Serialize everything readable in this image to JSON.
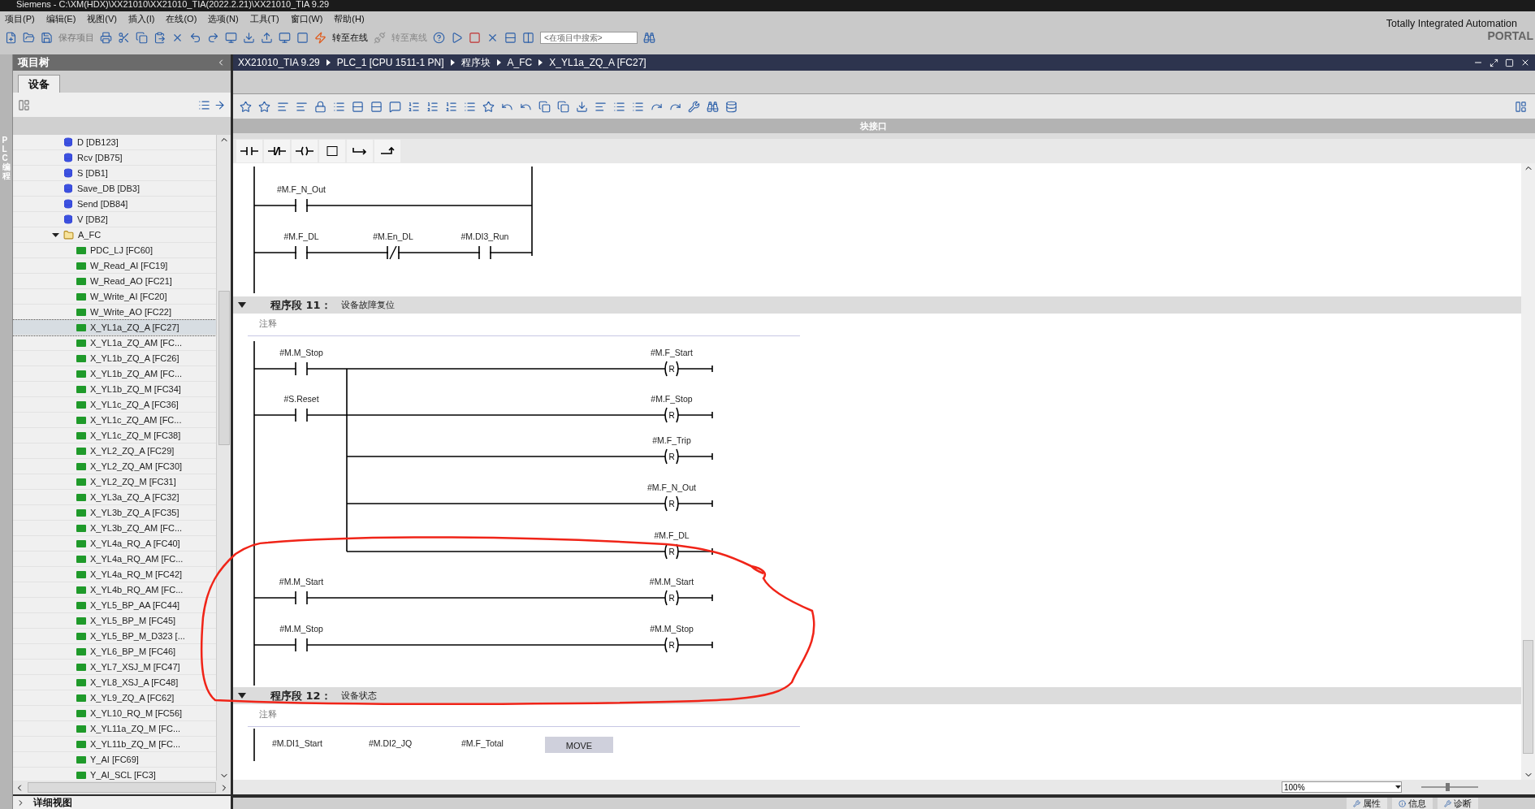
{
  "title_bar": {
    "title": "Siemens - C:\\XM(HDX)\\XX21010\\XX21010_TIA(2022.2.21)\\XX21010_TIA 9.29"
  },
  "menu": [
    "项目(P)",
    "编辑(E)",
    "视图(V)",
    "插入(I)",
    "在线(O)",
    "选项(N)",
    "工具(T)",
    "窗口(W)",
    "帮助(H)"
  ],
  "toolbar": {
    "save": "保存项目",
    "go_online": "转至在线",
    "go_offline": "转至离线",
    "search_placeholder": "<在项目中搜索>"
  },
  "brand": {
    "line_1": "Totally Integrated Automation",
    "line_2": "PORTAL"
  },
  "side_tab": "PLC 编程",
  "project_tree": {
    "title": "项目树",
    "tab": "设备",
    "items": [
      {
        "label": "D [DB123]",
        "kind": "db",
        "selected": false
      },
      {
        "label": "Rcv [DB75]",
        "kind": "db",
        "selected": false
      },
      {
        "label": "S [DB1]",
        "kind": "db",
        "selected": false
      },
      {
        "label": "Save_DB [DB3]",
        "kind": "db",
        "selected": false
      },
      {
        "label": "Send [DB84]",
        "kind": "db",
        "selected": false
      },
      {
        "label": "V [DB2]",
        "kind": "db",
        "selected": false
      },
      {
        "label": "A_FC",
        "kind": "folder",
        "selected": false,
        "expanded": true,
        "children": [
          {
            "label": "PDC_LJ [FC60]",
            "kind": "fc",
            "selected": false
          },
          {
            "label": "W_Read_AI [FC19]",
            "kind": "fc",
            "selected": false
          },
          {
            "label": "W_Read_AO [FC21]",
            "kind": "fc",
            "selected": false
          },
          {
            "label": "W_Write_AI [FC20]",
            "kind": "fc",
            "selected": false
          },
          {
            "label": "W_Write_AO [FC22]",
            "kind": "fc",
            "selected": false
          },
          {
            "label": "X_YL1a_ZQ_A [FC27]",
            "kind": "fc",
            "selected": true
          },
          {
            "label": "X_YL1a_ZQ_AM [FC...",
            "kind": "fc",
            "selected": false
          },
          {
            "label": "X_YL1b_ZQ_A [FC26]",
            "kind": "fc",
            "selected": false
          },
          {
            "label": "X_YL1b_ZQ_AM [FC...",
            "kind": "fc",
            "selected": false
          },
          {
            "label": "X_YL1b_ZQ_M [FC34]",
            "kind": "fc",
            "selected": false
          },
          {
            "label": "X_YL1c_ZQ_A [FC36]",
            "kind": "fc",
            "selected": false
          },
          {
            "label": "X_YL1c_ZQ_AM [FC...",
            "kind": "fc",
            "selected": false
          },
          {
            "label": "X_YL1c_ZQ_M [FC38]",
            "kind": "fc",
            "selected": false
          },
          {
            "label": "X_YL2_ZQ_A [FC29]",
            "kind": "fc",
            "selected": false
          },
          {
            "label": "X_YL2_ZQ_AM [FC30]",
            "kind": "fc",
            "selected": false
          },
          {
            "label": "X_YL2_ZQ_M [FC31]",
            "kind": "fc",
            "selected": false
          },
          {
            "label": "X_YL3a_ZQ_A [FC32]",
            "kind": "fc",
            "selected": false
          },
          {
            "label": "X_YL3b_ZQ_A [FC35]",
            "kind": "fc",
            "selected": false
          },
          {
            "label": "X_YL3b_ZQ_AM [FC...",
            "kind": "fc",
            "selected": false
          },
          {
            "label": "X_YL4a_RQ_A [FC40]",
            "kind": "fc",
            "selected": false
          },
          {
            "label": "X_YL4a_RQ_AM [FC...",
            "kind": "fc",
            "selected": false
          },
          {
            "label": "X_YL4a_RQ_M [FC42]",
            "kind": "fc",
            "selected": false
          },
          {
            "label": "X_YL4b_RQ_AM [FC...",
            "kind": "fc",
            "selected": false
          },
          {
            "label": "X_YL5_BP_AA [FC44]",
            "kind": "fc",
            "selected": false
          },
          {
            "label": "X_YL5_BP_M [FC45]",
            "kind": "fc",
            "selected": false
          },
          {
            "label": "X_YL5_BP_M_D323 [...",
            "kind": "fc",
            "selected": false
          },
          {
            "label": "X_YL6_BP_M [FC46]",
            "kind": "fc",
            "selected": false
          },
          {
            "label": "X_YL7_XSJ_M [FC47]",
            "kind": "fc",
            "selected": false
          },
          {
            "label": "X_YL8_XSJ_A [FC48]",
            "kind": "fc",
            "selected": false
          },
          {
            "label": "X_YL9_ZQ_A [FC62]",
            "kind": "fc",
            "selected": false
          },
          {
            "label": "X_YL10_RQ_M [FC56]",
            "kind": "fc",
            "selected": false
          },
          {
            "label": "X_YL11a_ZQ_M [FC...",
            "kind": "fc",
            "selected": false
          },
          {
            "label": "X_YL11b_ZQ_M [FC...",
            "kind": "fc",
            "selected": false
          },
          {
            "label": "Y_AI [FC69]",
            "kind": "fc",
            "selected": false
          },
          {
            "label": "Y_AI_SCL [FC3]",
            "kind": "fc",
            "selected": false
          }
        ]
      }
    ]
  },
  "detail_view": "详细视图",
  "breadcrumb": [
    "XX21010_TIA 9.29",
    "PLC_1 [CPU 1511-1 PN]",
    "程序块",
    "A_FC",
    "X_YL1a_ZQ_A [FC27]"
  ],
  "block_interface": "块接口",
  "network_10_tail": {
    "rungs": [
      {
        "contacts": [
          {
            "label": "#M.F_N_Out",
            "kind": "no"
          }
        ]
      },
      {
        "contacts": [
          {
            "label": "#M.F_DL",
            "kind": "no"
          },
          {
            "label": "#M.En_DL",
            "kind": "nc"
          },
          {
            "label": "#M.DI3_Run",
            "kind": "no"
          }
        ]
      }
    ]
  },
  "network_11": {
    "number": "程序段 11：",
    "title": "设备故障复位",
    "comment": "注释",
    "rungs": [
      {
        "contact": {
          "label": "#M.M_Stop",
          "kind": "no"
        },
        "coil": {
          "label": "#M.F_Start",
          "type": "R"
        }
      },
      {
        "contact": {
          "label": "#S.Reset",
          "kind": "no"
        },
        "coil": {
          "label": "#M.F_Stop",
          "type": "R"
        }
      },
      {
        "coil": {
          "label": "#M.F_Trip",
          "type": "R"
        }
      },
      {
        "coil": {
          "label": "#M.F_N_Out",
          "type": "R"
        }
      },
      {
        "coil": {
          "label": "#M.F_DL",
          "type": "R"
        }
      },
      {
        "contact": {
          "label": "#M.M_Start",
          "kind": "no"
        },
        "coil": {
          "label": "#M.M_Start",
          "type": "R"
        }
      },
      {
        "contact": {
          "label": "#M.M_Stop",
          "kind": "no"
        },
        "coil": {
          "label": "#M.M_Stop",
          "type": "R"
        }
      }
    ]
  },
  "network_12": {
    "number": "程序段 12：",
    "title": "设备状态",
    "comment": "注释",
    "operands": [
      "#M.DI1_Start",
      "#M.DI2_JQ",
      "#M.F_Total"
    ],
    "box": "MOVE"
  },
  "zoom": "100%",
  "zoom_slider": {
    "level": 0.45
  },
  "status_tabs": [
    "属性",
    "信息",
    "诊断"
  ]
}
